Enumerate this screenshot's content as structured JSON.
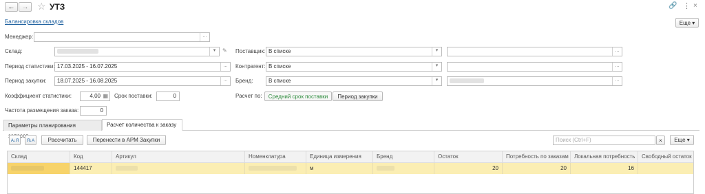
{
  "window": {
    "title": "УТЗ",
    "back_icon": "arrow-left-icon",
    "forward_icon": "arrow-right-icon",
    "star_icon": "star-icon",
    "link_icon": "link-icon",
    "menu_icon": "more-vertical-icon",
    "close_icon": "close-icon"
  },
  "nav": {
    "link_label": "Балансировка складов",
    "more_label": "Еще ▾"
  },
  "form": {
    "manager": {
      "label": "Менеджер:",
      "value": ""
    },
    "warehouse": {
      "label": "Склад:",
      "value": ""
    },
    "stat_period": {
      "label": "Период статистики:",
      "value": "17.03.2025 - 16.07.2025"
    },
    "purchase_period": {
      "label": "Период закупки:",
      "value": "18.07.2025 - 16.08.2025"
    },
    "stat_coef": {
      "label": "Коэффициент статистики:",
      "value": "4,00"
    },
    "delivery_term": {
      "label": "Срок поставки:",
      "value": "0"
    },
    "order_frequency": {
      "label": "Частота размещения заказа:",
      "value": "0"
    },
    "supplier": {
      "label": "Поставщик:",
      "value": "В списке"
    },
    "counterparty": {
      "label": "Контрагент:",
      "value": "В списке"
    },
    "brand": {
      "label": "Бренд:",
      "value": "В списке"
    },
    "calc_by": {
      "label": "Расчет по:",
      "options": [
        "Средний срок поставки",
        "Период закупки"
      ],
      "selected": "Средний срок поставки"
    }
  },
  "tabs": [
    {
      "label": "Параметры планирования запасов",
      "active": false
    },
    {
      "label": "Расчет количества к заказу",
      "active": true
    }
  ],
  "toolbar": {
    "sort_asc_label": "А↓Я",
    "sort_desc_label": "Я↓А",
    "calculate_label": "Рассчитать",
    "transfer_label": "Перенести в АРМ Закупки",
    "search_placeholder": "Поиск (Ctrl+F)",
    "clear_label": "×",
    "more_label": "Еще ▾"
  },
  "table": {
    "columns": [
      "Склад",
      "Код",
      "Артикул",
      "Номенклатура",
      "Единица измерения",
      "Бренд",
      "Остаток",
      "Потребность по заказам",
      "Локальная потребность",
      "Свободный остаток"
    ],
    "rows": [
      {
        "sklad": "",
        "code": "144417",
        "article": "",
        "nomenclature": "",
        "unit": "м",
        "brand": "",
        "stock": "20",
        "order_need": "20",
        "local_need": "16",
        "free_stock": ""
      }
    ]
  },
  "colors": {
    "accent_link": "#1c5f9e",
    "selected_row": "#fbeeb3",
    "selected_cell": "#f7d36a",
    "active_option": "#2a8a3a"
  }
}
